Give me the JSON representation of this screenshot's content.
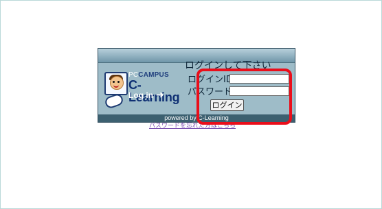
{
  "brand": {
    "small_prefix": "PC",
    "small_strong": "CAMPUS",
    "main": "C-Learning",
    "login_text": "Log in",
    "arrow_icon": "right-arrow-icon"
  },
  "form": {
    "title": "ログインして下さい",
    "id_label": "ログインID",
    "password_label": "パスワード",
    "id_value": "",
    "password_value": "",
    "button_label": "ログイン"
  },
  "footer": {
    "powered_by": "powered by C-Learning"
  },
  "forgot_password": "パスワードを忘れた方はこちら",
  "colors": {
    "panel_blue": "#9ebcc8",
    "header_dark": "#3c6070",
    "highlight_red": "#ea0e1a"
  }
}
